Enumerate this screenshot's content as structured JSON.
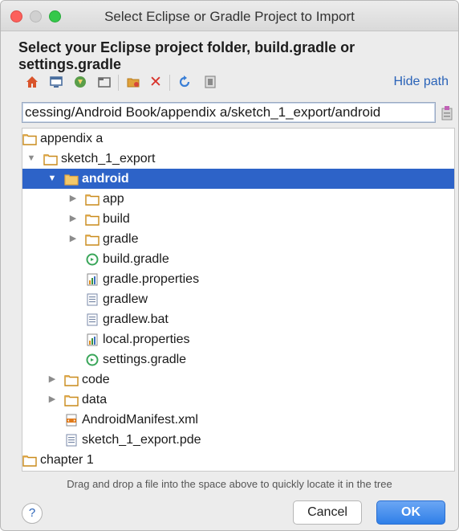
{
  "window": {
    "title": "Select Eclipse or Gradle Project to Import"
  },
  "heading": "Select your Eclipse project folder, build.gradle or settings.gradle",
  "toolbar": {
    "icons": [
      "home-icon",
      "desktop-icon",
      "project-icon",
      "module-icon",
      "new-folder-icon",
      "delete-icon",
      "refresh-icon",
      "show-hidden-icon"
    ],
    "hide_path_label": "Hide path"
  },
  "path": {
    "value": "cessing/Android Book/appendix a/sketch_1_export/android"
  },
  "tree": {
    "items": [
      {
        "label": "appendix a",
        "type": "folder",
        "expanded": true
      },
      {
        "label": "sketch_1_export",
        "type": "folder",
        "expanded": true
      },
      {
        "label": "android",
        "type": "folder",
        "expanded": true,
        "selected": true
      },
      {
        "label": "app",
        "type": "folder",
        "expanded": false
      },
      {
        "label": "build",
        "type": "folder",
        "expanded": false
      },
      {
        "label": "gradle",
        "type": "folder",
        "expanded": false
      },
      {
        "label": "build.gradle",
        "type": "gradle-file"
      },
      {
        "label": "gradle.properties",
        "type": "properties-file"
      },
      {
        "label": "gradlew",
        "type": "text-file"
      },
      {
        "label": "gradlew.bat",
        "type": "text-file"
      },
      {
        "label": "local.properties",
        "type": "properties-file"
      },
      {
        "label": "settings.gradle",
        "type": "gradle-file"
      },
      {
        "label": "code",
        "type": "folder",
        "expanded": false
      },
      {
        "label": "data",
        "type": "folder",
        "expanded": false
      },
      {
        "label": "AndroidManifest.xml",
        "type": "xml-file"
      },
      {
        "label": "sketch_1_export.pde",
        "type": "text-file"
      },
      {
        "label": "chapter 1",
        "type": "folder",
        "expanded": false
      }
    ]
  },
  "hint": "Drag and drop a file into the space above to quickly locate it in the tree",
  "buttons": {
    "help": "?",
    "cancel": "Cancel",
    "ok": "OK"
  },
  "colors": {
    "selection": "#2d63c8",
    "link": "#2a63b8",
    "ok_button": "#2f7fe8",
    "folder": "#c98a1a"
  }
}
